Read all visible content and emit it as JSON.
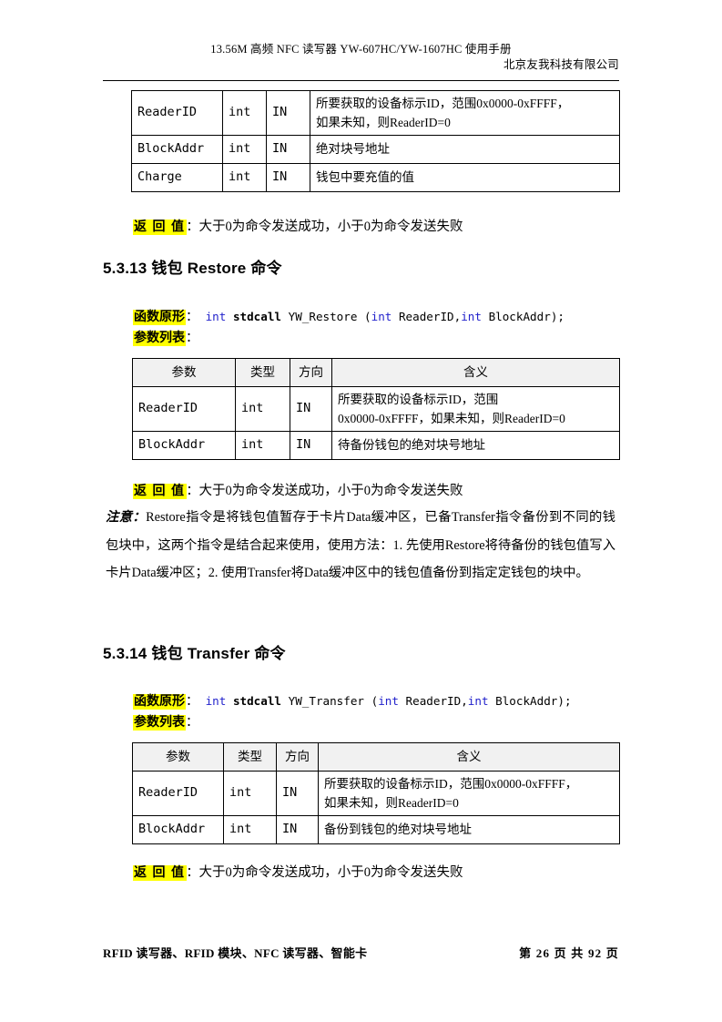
{
  "header": {
    "title_line1": "13.56M  高频 NFC 读写器 YW-607HC/YW-1607HC 使用手册",
    "company": "北京友我科技有限公司"
  },
  "footer": {
    "left": "RFID 读写器、RFID 模块、NFC 读写器、智能卡",
    "right": "第 26 页 共 92 页"
  },
  "labels": {
    "return_label": "返 回 值",
    "return_colon": "：",
    "return_value": "大于0为命令发送成功，小于0为命令发送失败",
    "proto_label": "函数原形",
    "proto_colon": "：",
    "plist_label": "参数列表",
    "plist_colon": "：",
    "note_label": "注意："
  },
  "table_top": {
    "rows": [
      {
        "param": "ReaderID",
        "type": "int",
        "dir": "IN",
        "desc_line1": "所要获取的设备标示ID，范围0x0000-0xFFFF，",
        "desc_line2": "如果未知，则ReaderID=0"
      },
      {
        "param": "BlockAddr",
        "type": "int",
        "dir": "IN",
        "desc_line1": "绝对块号地址",
        "desc_line2": ""
      },
      {
        "param": "Charge",
        "type": "int",
        "dir": "IN",
        "desc_line1": "钱包中要充值的值",
        "desc_line2": ""
      }
    ]
  },
  "section_restore": {
    "heading": "5.3.13 钱包 Restore  命令",
    "prototype": {
      "ret_type": "int",
      "call_conv": "stdcall",
      "fn_name": "YW_Restore",
      "paren_open": "(",
      "arg1_type": "int",
      "arg1_name": "ReaderID,",
      "arg2_type": "int",
      "arg2_name": "BlockAddr",
      "paren_close": ");"
    },
    "table": {
      "headers": [
        "参数",
        "类型",
        "方向",
        "含义"
      ],
      "rows": [
        {
          "param": "ReaderID",
          "type": "int",
          "dir": "IN",
          "desc_line1": "所要获取的设备标示ID，范围",
          "desc_line2": "0x0000-0xFFFF，如果未知，则ReaderID=0"
        },
        {
          "param": "BlockAddr",
          "type": "int",
          "dir": "IN",
          "desc_line1": "待备份钱包的绝对块号地址",
          "desc_line2": ""
        }
      ]
    },
    "note_body": "Restore指令是将钱包值暂存于卡片Data缓冲区，已备Transfer指令备份到不同的钱包块中，这两个指令是结合起来使用，使用方法：1. 先使用Restore将待备份的钱包值写入卡片Data缓冲区；2. 使用Transfer将Data缓冲区中的钱包值备份到指定定钱包的块中。"
  },
  "section_transfer": {
    "heading": "5.3.14 钱包 Transfer 命令",
    "prototype": {
      "ret_type": "int",
      "call_conv": "stdcall",
      "fn_name": "YW_Transfer",
      "paren_open": "(",
      "arg1_type": "int",
      "arg1_name": "ReaderID,",
      "arg2_type": "int",
      "arg2_name": "BlockAddr",
      "paren_close": ");"
    },
    "table": {
      "headers": [
        "参数",
        "类型",
        "方向",
        "含义"
      ],
      "rows": [
        {
          "param": "ReaderID",
          "type": "int",
          "dir": "IN",
          "desc_line1": "所要获取的设备标示ID，范围0x0000-0xFFFF，",
          "desc_line2": "如果未知，则ReaderID=0"
        },
        {
          "param": "BlockAddr",
          "type": "int",
          "dir": "IN",
          "desc_line1": "备份到钱包的绝对块号地址",
          "desc_line2": ""
        }
      ]
    }
  },
  "colors": {
    "highlight": "#ffff00",
    "keyword": "#2222cc",
    "table_header_bg": "#f1f1f1",
    "rule": "#000000"
  }
}
